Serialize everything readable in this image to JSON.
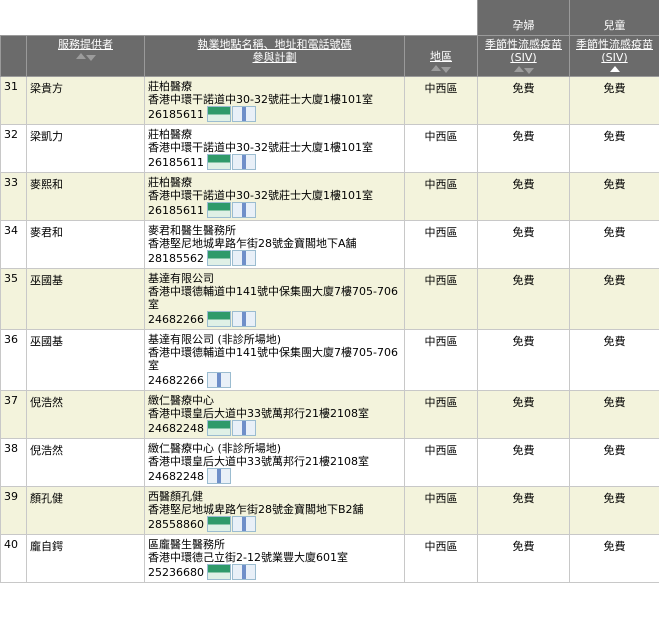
{
  "header": {
    "group_pregnant": "孕婦",
    "group_children": "兒童",
    "col_provider": "服務提供者",
    "col_location_line1": "執業地點名稱、地址和電話號碼",
    "col_location_line2": "參與計劃",
    "col_district": "地區",
    "col_vaccine_line1": "季節性流感疫苗",
    "col_vaccine_line2": "(SIV)",
    "col_vaccine2_line1": "季節性流感疫苗",
    "col_vaccine2_line2": "(SIV)"
  },
  "rows": [
    {
      "no": "31",
      "provider": "梁貴方",
      "clinic": "莊柏醫療",
      "address": "香港中環干諾道中30-32號莊士大廈1樓101室",
      "phone": "26185611",
      "district": "中西區",
      "pregnant": "免費",
      "children": "免費",
      "badges": [
        "green",
        "blue"
      ]
    },
    {
      "no": "32",
      "provider": "梁凱力",
      "clinic": "莊柏醫療",
      "address": "香港中環干諾道中30-32號莊士大廈1樓101室",
      "phone": "26185611",
      "district": "中西區",
      "pregnant": "免費",
      "children": "免費",
      "badges": [
        "green",
        "blue"
      ]
    },
    {
      "no": "33",
      "provider": "麥熙和",
      "clinic": "莊柏醫療",
      "address": "香港中環干諾道中30-32號莊士大廈1樓101室",
      "phone": "26185611",
      "district": "中西區",
      "pregnant": "免費",
      "children": "免費",
      "badges": [
        "green",
        "blue"
      ]
    },
    {
      "no": "34",
      "provider": "麥君和",
      "clinic": "麥君和醫生醫務所",
      "address": "香港堅尼地城卑路乍街28號金寶閣地下A舖",
      "phone": "28185562",
      "district": "中西區",
      "pregnant": "免費",
      "children": "免費",
      "badges": [
        "green",
        "blue"
      ]
    },
    {
      "no": "35",
      "provider": "巫國基",
      "clinic": "基達有限公司",
      "address": "香港中環德輔道中141號中保集團大廈7樓705-706室",
      "phone": "24682266",
      "district": "中西區",
      "pregnant": "免費",
      "children": "免費",
      "badges": [
        "green",
        "blue"
      ]
    },
    {
      "no": "36",
      "provider": "巫國基",
      "clinic": "基達有限公司 (非診所場地)",
      "address": "香港中環德輔道中141號中保集團大廈7樓705-706室",
      "phone": "24682266",
      "district": "中西區",
      "pregnant": "免費",
      "children": "免費",
      "badges": [
        "blue"
      ]
    },
    {
      "no": "37",
      "provider": "倪浩然",
      "clinic": "緻仁醫療中心",
      "address": "香港中環皇后大道中33號萬邦行21樓2108室",
      "phone": "24682248",
      "district": "中西區",
      "pregnant": "免費",
      "children": "免費",
      "badges": [
        "green",
        "blue"
      ]
    },
    {
      "no": "38",
      "provider": "倪浩然",
      "clinic": "緻仁醫療中心 (非診所場地)",
      "address": "香港中環皇后大道中33號萬邦行21樓2108室",
      "phone": "24682248",
      "district": "中西區",
      "pregnant": "免費",
      "children": "免費",
      "badges": [
        "blue"
      ]
    },
    {
      "no": "39",
      "provider": "顏孔健",
      "clinic": "西醫顏孔健",
      "address": "香港堅尼地城卑路乍街28號金寶閣地下B2舖",
      "phone": "28558860",
      "district": "中西區",
      "pregnant": "免費",
      "children": "免費",
      "badges": [
        "green",
        "blue"
      ]
    },
    {
      "no": "40",
      "provider": "龐自鍔",
      "clinic": "區龐醫生醫務所",
      "address": "香港中環德己立街2-12號業豐大廈601室",
      "phone": "25236680",
      "district": "中西區",
      "pregnant": "免費",
      "children": "免費",
      "badges": [
        "green",
        "blue"
      ]
    }
  ]
}
